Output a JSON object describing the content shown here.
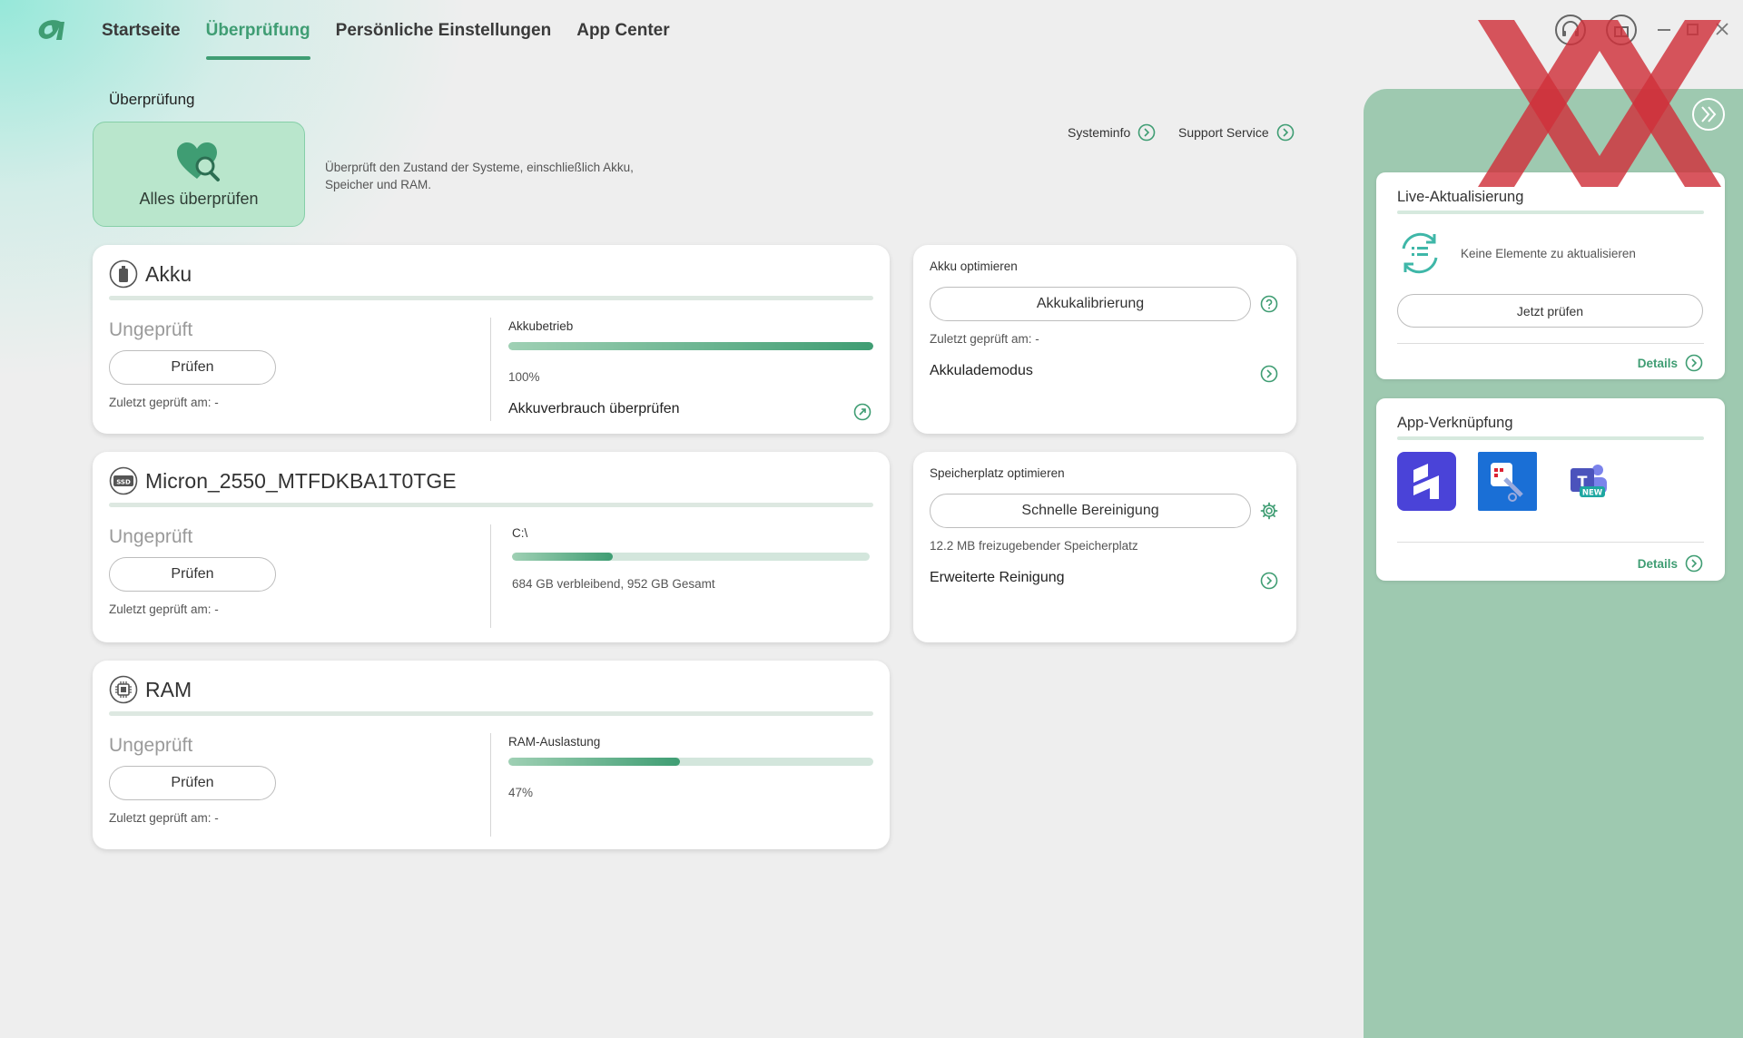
{
  "nav": {
    "tabs": [
      {
        "label": "Startseite"
      },
      {
        "label": "Überprüfung"
      },
      {
        "label": "Persönliche Einstellungen"
      },
      {
        "label": "App Center"
      }
    ]
  },
  "section": {
    "title": "Überprüfung",
    "check_all_label": "Alles überprüfen",
    "description": "Überprüft den Zustand der Systeme, einschließlich Akku, Speicher und RAM.",
    "links": [
      {
        "label": "Systeminfo"
      },
      {
        "label": "Support Service"
      }
    ]
  },
  "battery": {
    "title": "Akku",
    "status": "Ungeprüft",
    "check_label": "Prüfen",
    "last_checked": "Zuletzt geprüft am: -",
    "metric_label": "Akkubetrieb",
    "metric_value": "100%",
    "level": 1.0,
    "usage_link": "Akkuverbrauch überprüfen"
  },
  "disk": {
    "title": "Micron_2550_MTFDKBA1T0TGE",
    "status": "Ungeprüft",
    "check_label": "Prüfen",
    "last_checked": "Zuletzt geprüft am: -",
    "drive": "C:\\",
    "usage_text": "684 GB verbleibend, 952 GB Gesamt",
    "used_fraction": 0.281
  },
  "ram": {
    "title": "RAM",
    "status": "Ungeprüft",
    "check_label": "Prüfen",
    "last_checked": "Zuletzt geprüft am: -",
    "metric_label": "RAM-Auslastung",
    "metric_value": "47%",
    "level": 0.47
  },
  "battery_opt": {
    "title": "Akku optimieren",
    "button": "Akkukalibrierung",
    "last_checked": "Zuletzt geprüft am: -",
    "mode_link": "Akkulademodus"
  },
  "storage_opt": {
    "title": "Speicherplatz optimieren",
    "button": "Schnelle Bereinigung",
    "freeable": "12.2 MB freizugebender Speicherplatz",
    "advanced_link": "Erweiterte Reinigung"
  },
  "live_update": {
    "title": "Live-Aktualisierung",
    "message": "Keine Elemente zu aktualisieren",
    "button": "Jetzt prüfen",
    "details": "Details"
  },
  "app_links": {
    "title": "App-Verknüpfung",
    "details": "Details",
    "apps": [
      {
        "icon": "app-icon-blue-logo",
        "color": "#4a43d8"
      },
      {
        "icon": "app-icon-snipping",
        "color": "#1a6fd6"
      },
      {
        "icon": "app-icon-teams-new",
        "color": "#5b5fc7",
        "badge": "NEW"
      }
    ]
  },
  "colors": {
    "accent": "#3f9d73",
    "panel": "#9ec9b0",
    "watermark": "#d0313a"
  }
}
